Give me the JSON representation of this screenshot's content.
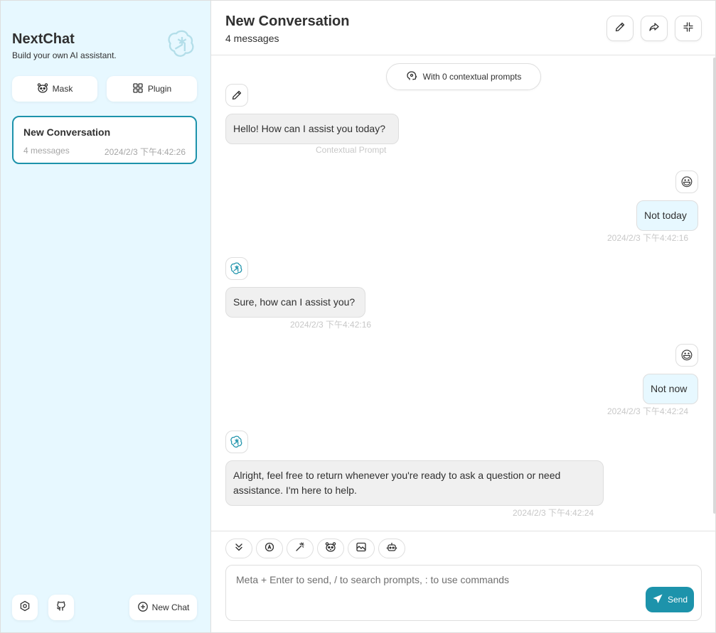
{
  "colors": {
    "accent": "#1d93ab",
    "sidebar_bg": "#e7f8ff",
    "bot_bubble": "#f0f0f0",
    "user_bubble": "#e7f8ff"
  },
  "sidebar": {
    "app_name": "NextChat",
    "tagline": "Build your own AI assistant.",
    "mask_label": "Mask",
    "plugin_label": "Plugin",
    "conversations": [
      {
        "title": "New Conversation",
        "count": "4 messages",
        "date": "2024/2/3 下午4:42:26"
      }
    ],
    "new_chat_label": "New Chat"
  },
  "header": {
    "title": "New Conversation",
    "subtitle": "4 messages"
  },
  "chat": {
    "context_pill": "With 0 contextual prompts",
    "messages": [
      {
        "role": "bot",
        "text": "Hello! How can I assist you today?",
        "meta": "Contextual Prompt"
      },
      {
        "role": "user",
        "text": "Not today",
        "meta": "2024/2/3 下午4:42:16",
        "avatar": "😃"
      },
      {
        "role": "bot",
        "text": "Sure, how can I assist you?",
        "meta": "2024/2/3 下午4:42:16"
      },
      {
        "role": "user",
        "text": "Not now",
        "meta": "2024/2/3 下午4:42:24",
        "avatar": "😃"
      },
      {
        "role": "bot",
        "text": "Alright, feel free to return whenever you're ready to ask a question or need assistance. I'm here to help.",
        "meta": "2024/2/3 下午4:42:24"
      }
    ]
  },
  "input": {
    "placeholder": "Meta + Enter to send, / to search prompts, : to use commands",
    "send_label": "Send",
    "toolbar_icons": [
      "chevrons-down-icon",
      "auto-theme-icon",
      "magic-wand-icon",
      "mask-icon",
      "image-icon",
      "robot-icon"
    ]
  }
}
